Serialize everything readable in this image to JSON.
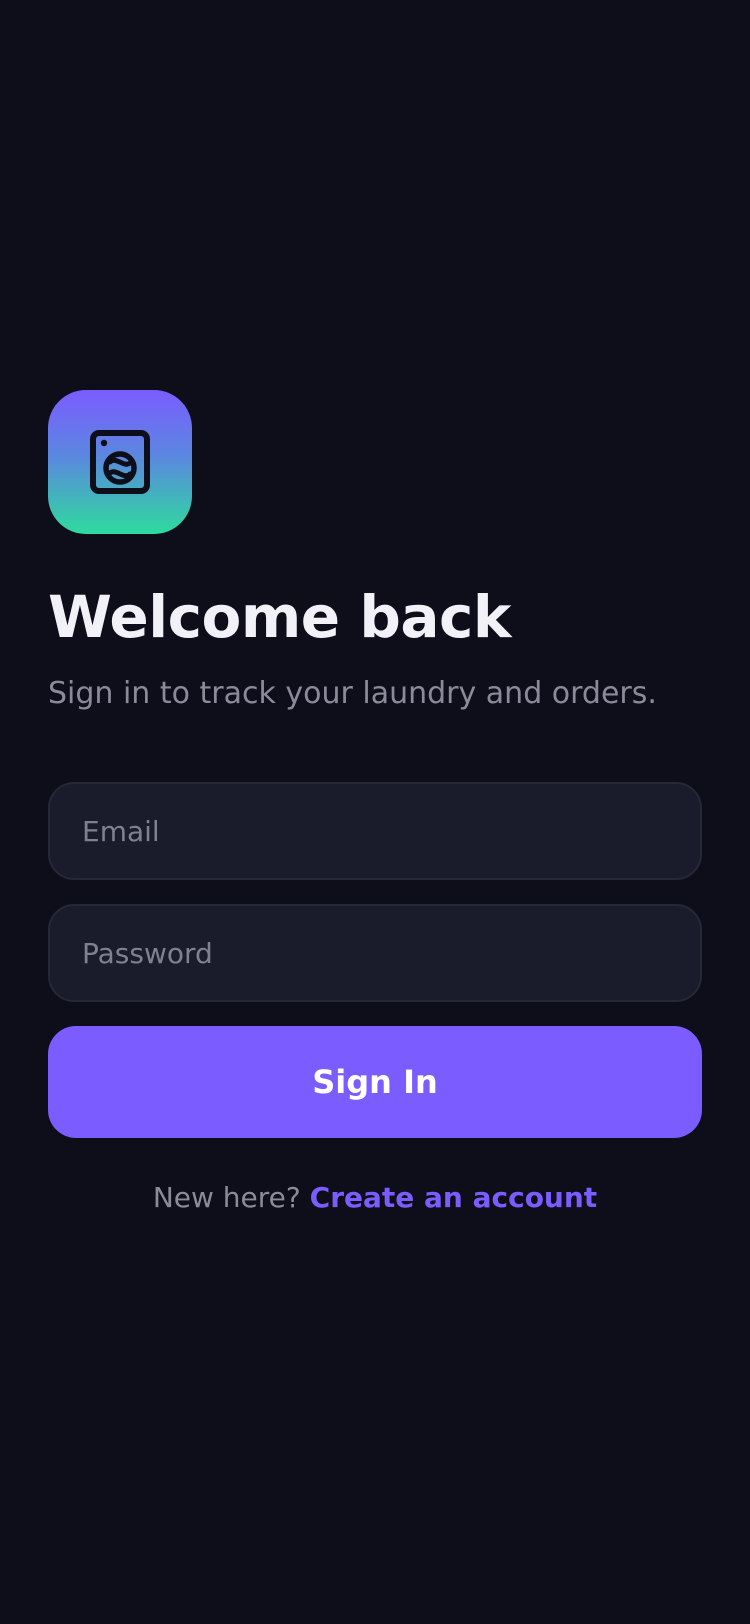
{
  "app_icon": {
    "name": "washing-machine-icon",
    "gradient_top": "#7b5cff",
    "gradient_bottom": "#2edb9d"
  },
  "header": {
    "title": "Welcome back",
    "subtitle": "Sign in to track your laundry and orders."
  },
  "form": {
    "email": {
      "value": "",
      "placeholder": "Email"
    },
    "password": {
      "value": "",
      "placeholder": "Password"
    },
    "submit_label": "Sign In"
  },
  "footer": {
    "prompt": "New here?",
    "link_label": "Create an account"
  },
  "colors": {
    "background": "#0e0e1a",
    "accent": "#7b5cff",
    "field_background": "#1a1c2b",
    "muted_text": "#8a8b99"
  }
}
